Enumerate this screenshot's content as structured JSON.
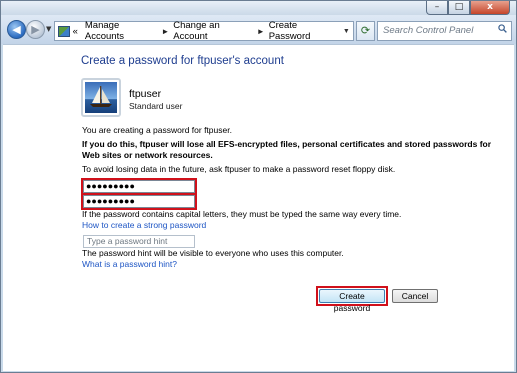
{
  "window": {
    "caption": {
      "minimize": "–",
      "maximize": "□",
      "close": "x"
    }
  },
  "toolbar": {
    "breadcrumb": [
      "Manage Accounts",
      "Change an Account",
      "Create Password"
    ],
    "breadcrumb_prefix": "«",
    "separator": "►",
    "search_placeholder": "Search Control Panel"
  },
  "page": {
    "title": "Create a password for ftpuser's account",
    "user": {
      "name": "ftpuser",
      "type": "Standard user"
    },
    "info": "You are creating a password for ftpuser.",
    "warning_line1": "If you do this, ftpuser will lose all EFS-encrypted files, personal certificates and stored passwords for",
    "warning_line2": "Web sites or network resources.",
    "advice": "To avoid losing data in the future, ask ftpuser to make a password reset floppy disk.",
    "password_mask": "●●●●●●●●●",
    "confirm_mask": "●●●●●●●●●",
    "caps_note": "If the password contains capital letters, they must be typed the same way every time.",
    "strong_link": "How to create a strong password",
    "hint_placeholder": "Type a password hint",
    "hint_note": "The password hint will be visible to everyone who uses this computer.",
    "hint_link": "What is a password hint?",
    "create_button": "Create password",
    "cancel_button": "Cancel"
  },
  "colors": {
    "highlight": "#d0111b",
    "title": "#1e3d8f",
    "link": "#1d55c4"
  }
}
